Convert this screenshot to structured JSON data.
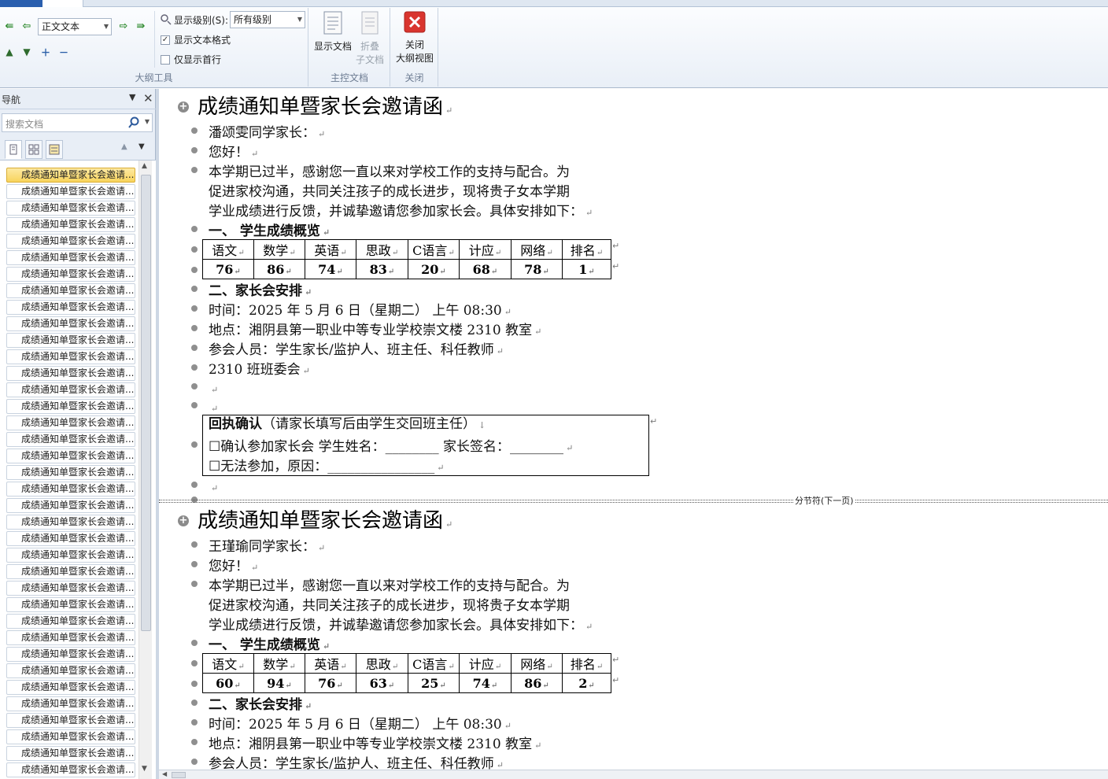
{
  "ribbon": {
    "outline_tools": {
      "level_select": "正文文本",
      "show_level_label": "显示级别(S):",
      "show_level_value": "所有级别",
      "show_text_format": "显示文本格式",
      "show_first_line_only": "仅显示首行",
      "group_label": "大纲工具"
    },
    "master_doc": {
      "show_document": "显示文档",
      "collapse_line1": "折叠",
      "collapse_line2": "子文档",
      "group_label": "主控文档"
    },
    "close_group": {
      "close_line1": "关闭",
      "close_line2": "大纲视图",
      "group_label": "关闭"
    }
  },
  "nav": {
    "title": "导航",
    "search_placeholder": "搜索文档",
    "item_label": "成绩通知单暨家长会邀请...",
    "item_count": 37,
    "selected_index": 0
  },
  "document": {
    "section_break_label": "分节符(下一页)",
    "sections": [
      {
        "title": "成绩通知单暨家长会邀请函",
        "greeting_name": "潘颂雯同学家长：",
        "hello": "您好！",
        "body_lines": [
          "本学期已过半，感谢您一直以来对学校工作的支持与配合。为",
          "促进家校沟通，共同关注孩子的成长进步，现将贵子女本学期",
          "学业成绩进行反馈，并诚挚邀请您参加家长会。具体安排如下："
        ],
        "heading1": "一、 学生成绩概览",
        "subjects": [
          "语文",
          "数学",
          "英语",
          "思政",
          "C语言",
          "计应",
          "网络",
          "排名"
        ],
        "scores": [
          "76",
          "86",
          "74",
          "83",
          "20",
          "68",
          "78",
          "1"
        ],
        "heading2": "二、家长会安排",
        "time": "时间：2025 年 5 月 6 日（星期二） 上午 08:30",
        "place": "地点：湘阴县第一职业中等专业学校崇文楼 2310 教室",
        "attendees": "参会人员：学生家长/监护人、班主任、科任教师",
        "committee": "2310 班班委会",
        "receipt_title": "回执确认",
        "receipt_note": "（请家长填写后由学生交回班主任）",
        "receipt_line1": "☐确认参加家长会  学生姓名：________  家长签名：________",
        "receipt_line2": "☐无法参加，原因：________________"
      },
      {
        "title": "成绩通知单暨家长会邀请函",
        "greeting_name": "王瑾瑜同学家长：",
        "hello": "您好！",
        "body_lines": [
          "本学期已过半，感谢您一直以来对学校工作的支持与配合。为",
          "促进家校沟通，共同关注孩子的成长进步，现将贵子女本学期",
          "学业成绩进行反馈，并诚挚邀请您参加家长会。具体安排如下："
        ],
        "heading1": "一、 学生成绩概览",
        "subjects": [
          "语文",
          "数学",
          "英语",
          "思政",
          "C语言",
          "计应",
          "网络",
          "排名"
        ],
        "scores": [
          "60",
          "94",
          "76",
          "63",
          "25",
          "74",
          "86",
          "2"
        ],
        "heading2": "二、家长会安排",
        "time": "时间：2025 年 5 月 6 日（星期二） 上午 08:30",
        "place": "地点：湘阴县第一职业中等专业学校崇文楼 2310 教室",
        "attendees": "参会人员：学生家长/监护人、班主任、科任教师"
      }
    ]
  },
  "colors": {
    "selected_nav": "#f8d45c",
    "ribbon_bg": "#e9eff7",
    "close_button": "#d9352e"
  }
}
